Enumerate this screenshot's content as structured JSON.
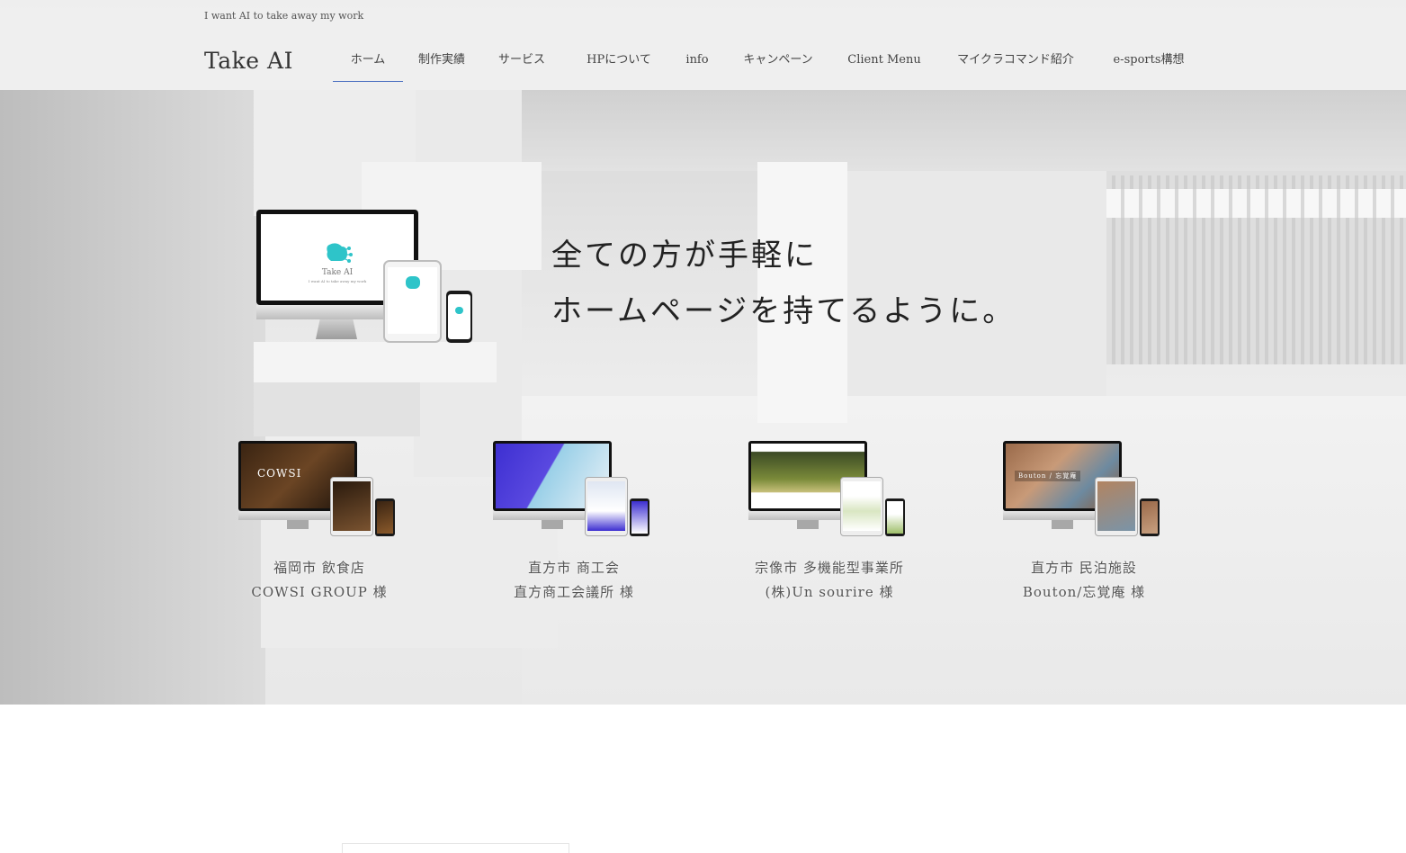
{
  "header": {
    "tagline": "I want AI to take away my work",
    "logo": "Take AI",
    "nav": [
      {
        "label": "ホーム",
        "active": true
      },
      {
        "label": "制作実績",
        "active": false
      },
      {
        "label": "サービス",
        "active": false
      },
      {
        "label": "HPについて",
        "active": false
      },
      {
        "label": "info",
        "active": false
      },
      {
        "label": "キャンペーン",
        "active": false
      },
      {
        "label": "Client Menu",
        "active": false
      },
      {
        "label": "マイクラコマンド紹介",
        "active": false
      },
      {
        "label": "e-sports構想",
        "active": false
      }
    ],
    "active_color": "#4a6fc0"
  },
  "hero": {
    "catch_line1": "全ての方が手軽に",
    "catch_line2": "ホームページを持てるように。",
    "device_logo_text": "Take AI",
    "device_logo_sub": "I want AI to take away my work",
    "device_icon": "brain-circuit-icon",
    "accent_color": "#2ec4c9"
  },
  "works": [
    {
      "line1": "福岡市 飲食店",
      "line2": "COWSI GROUP 様",
      "screen_text": "COWSI",
      "theme": "dark-restaurant"
    },
    {
      "line1": "直方市 商工会",
      "line2": "直方商工会議所 様",
      "screen_text": "",
      "theme": "blue-isometric"
    },
    {
      "line1": "宗像市 多機能型事業所",
      "line2": "(株)Un sourire 様",
      "screen_text": "",
      "theme": "green-field"
    },
    {
      "line1": "直方市 民泊施設",
      "line2": "Bouton/忘覚庵 様",
      "screen_text": "Bouton / 忘覚庵",
      "theme": "wooden-house"
    }
  ]
}
